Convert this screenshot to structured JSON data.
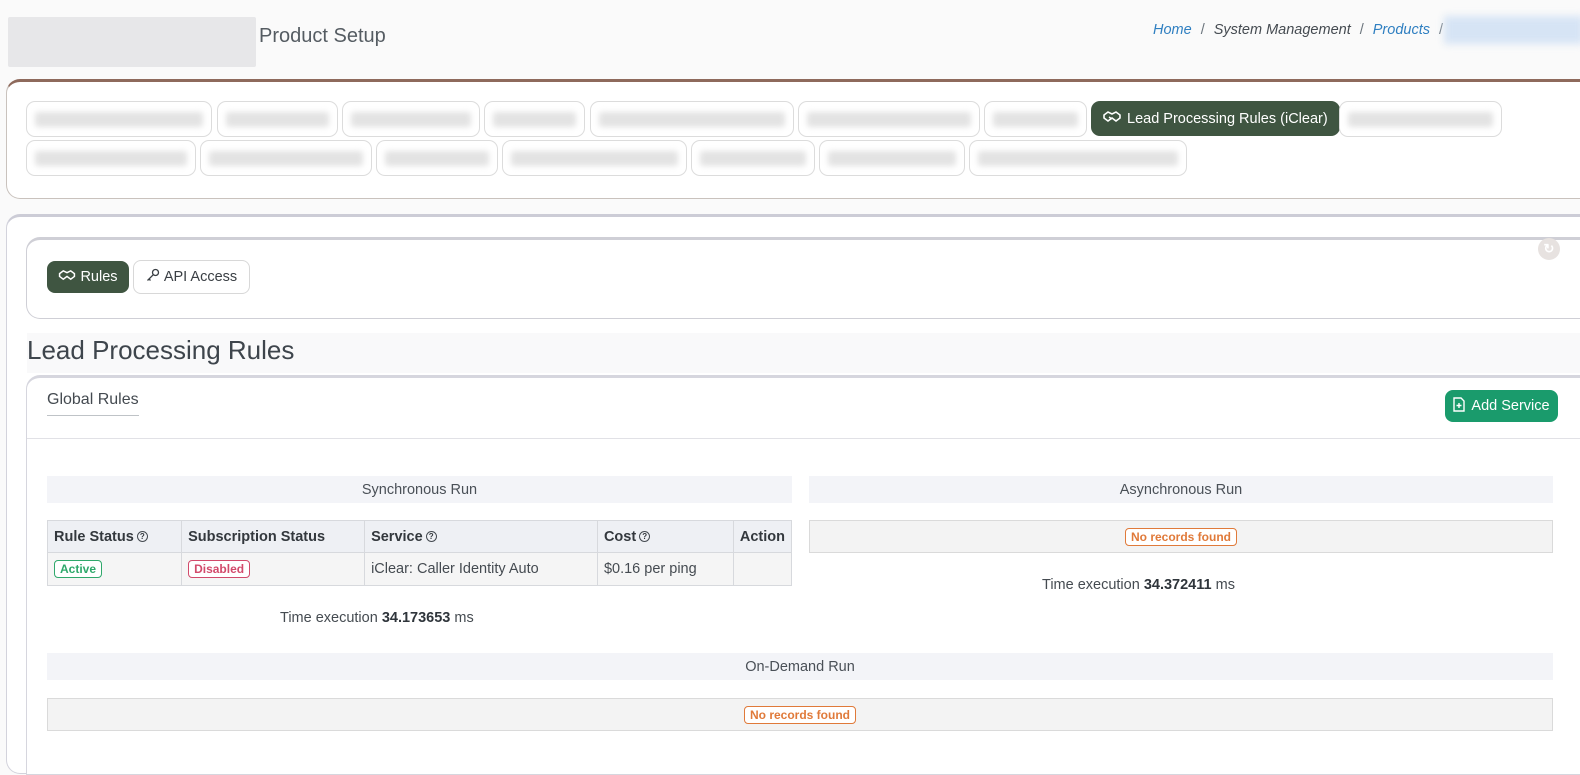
{
  "header": {
    "title": "Product Setup",
    "breadcrumbs": [
      {
        "label": "Home",
        "link": true
      },
      {
        "label": "System Management",
        "link": false
      },
      {
        "label": "Products",
        "link": true
      }
    ]
  },
  "top_tabs": {
    "active_label": "Lead Processing Rules (iClear)"
  },
  "subnav": {
    "rules_label": "Rules",
    "api_label": "API Access"
  },
  "page": {
    "heading": "Lead Processing Rules",
    "global_rules_label": "Global Rules",
    "add_service_label": "Add Service"
  },
  "sync_run": {
    "title": "Synchronous Run",
    "columns": [
      "Rule Status",
      "Subscription Status",
      "Service",
      "Cost",
      "Action"
    ],
    "rows": [
      {
        "rule_status": "Active",
        "subscription_status": "Disabled",
        "service": "iClear: Caller Identity Auto",
        "cost": "$0.16 per ping",
        "action": ""
      }
    ],
    "time_prefix": "Time execution",
    "time_value": "34.173653",
    "time_unit": "ms"
  },
  "async_run": {
    "title": "Asynchronous Run",
    "empty_label": "No records found",
    "time_prefix": "Time execution",
    "time_value": "34.372411",
    "time_unit": "ms"
  },
  "ondemand_run": {
    "title": "On-Demand Run",
    "empty_label": "No records found"
  },
  "colors": {
    "accent_dark_green": "#3f5541",
    "add_button_green": "#1a9b6c",
    "link_blue": "#2f7fc1",
    "badge_active": "#2fa86b",
    "badge_disabled": "#d24a6b",
    "badge_empty": "#e07a3a"
  }
}
